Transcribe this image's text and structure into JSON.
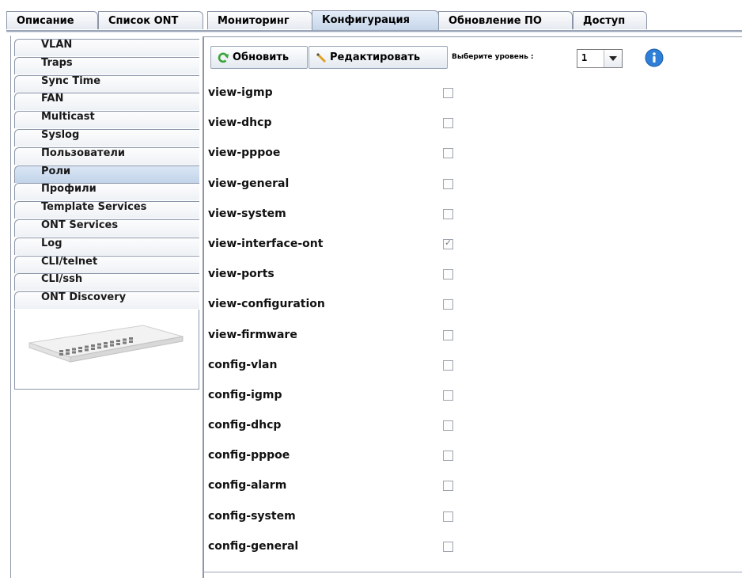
{
  "top_tabs": [
    {
      "label": "Описание"
    },
    {
      "label": "Список ONT"
    },
    {
      "label": "Мониторинг"
    },
    {
      "label": "Конфигурация",
      "active": true
    },
    {
      "label": "Обновление ПО"
    },
    {
      "label": "Доступ"
    }
  ],
  "sidebar": {
    "items": [
      {
        "label": "VLAN"
      },
      {
        "label": "Traps"
      },
      {
        "label": "Sync Time"
      },
      {
        "label": "FAN"
      },
      {
        "label": "Multicast"
      },
      {
        "label": "Syslog"
      },
      {
        "label": "Пользователи"
      },
      {
        "label": "Роли",
        "active": true
      },
      {
        "label": "Профили"
      },
      {
        "label": "Template Services"
      },
      {
        "label": "ONT Services"
      },
      {
        "label": "Log"
      },
      {
        "label": "CLI/telnet"
      },
      {
        "label": "CLI/ssh"
      },
      {
        "label": "ONT Discovery"
      }
    ],
    "image_icon": "network-switch-device-image"
  },
  "toolbar": {
    "refresh_label": "Обновить",
    "refresh_icon": "refresh-icon",
    "edit_label": "Редактировать",
    "edit_icon": "pencil-icon",
    "level_label": "Выберите уровень :",
    "level_value": "1",
    "info_icon": "info-icon"
  },
  "permissions": [
    {
      "name": "view-igmp",
      "checked": false
    },
    {
      "name": "view-dhcp",
      "checked": false
    },
    {
      "name": "view-pppoe",
      "checked": false
    },
    {
      "name": "view-general",
      "checked": false
    },
    {
      "name": "view-system",
      "checked": false
    },
    {
      "name": "view-interface-ont",
      "checked": true
    },
    {
      "name": "view-ports",
      "checked": false
    },
    {
      "name": "view-configuration",
      "checked": false
    },
    {
      "name": "view-firmware",
      "checked": false
    },
    {
      "name": "config-vlan",
      "checked": false
    },
    {
      "name": "config-igmp",
      "checked": false
    },
    {
      "name": "config-dhcp",
      "checked": false
    },
    {
      "name": "config-pppoe",
      "checked": false
    },
    {
      "name": "config-alarm",
      "checked": false
    },
    {
      "name": "config-system",
      "checked": false
    },
    {
      "name": "config-general",
      "checked": false
    }
  ],
  "colors": {
    "active_tab": "#c6d6ea",
    "border": "#8c96a8",
    "info": "#2f7fd8",
    "refresh": "#3aa33a"
  }
}
